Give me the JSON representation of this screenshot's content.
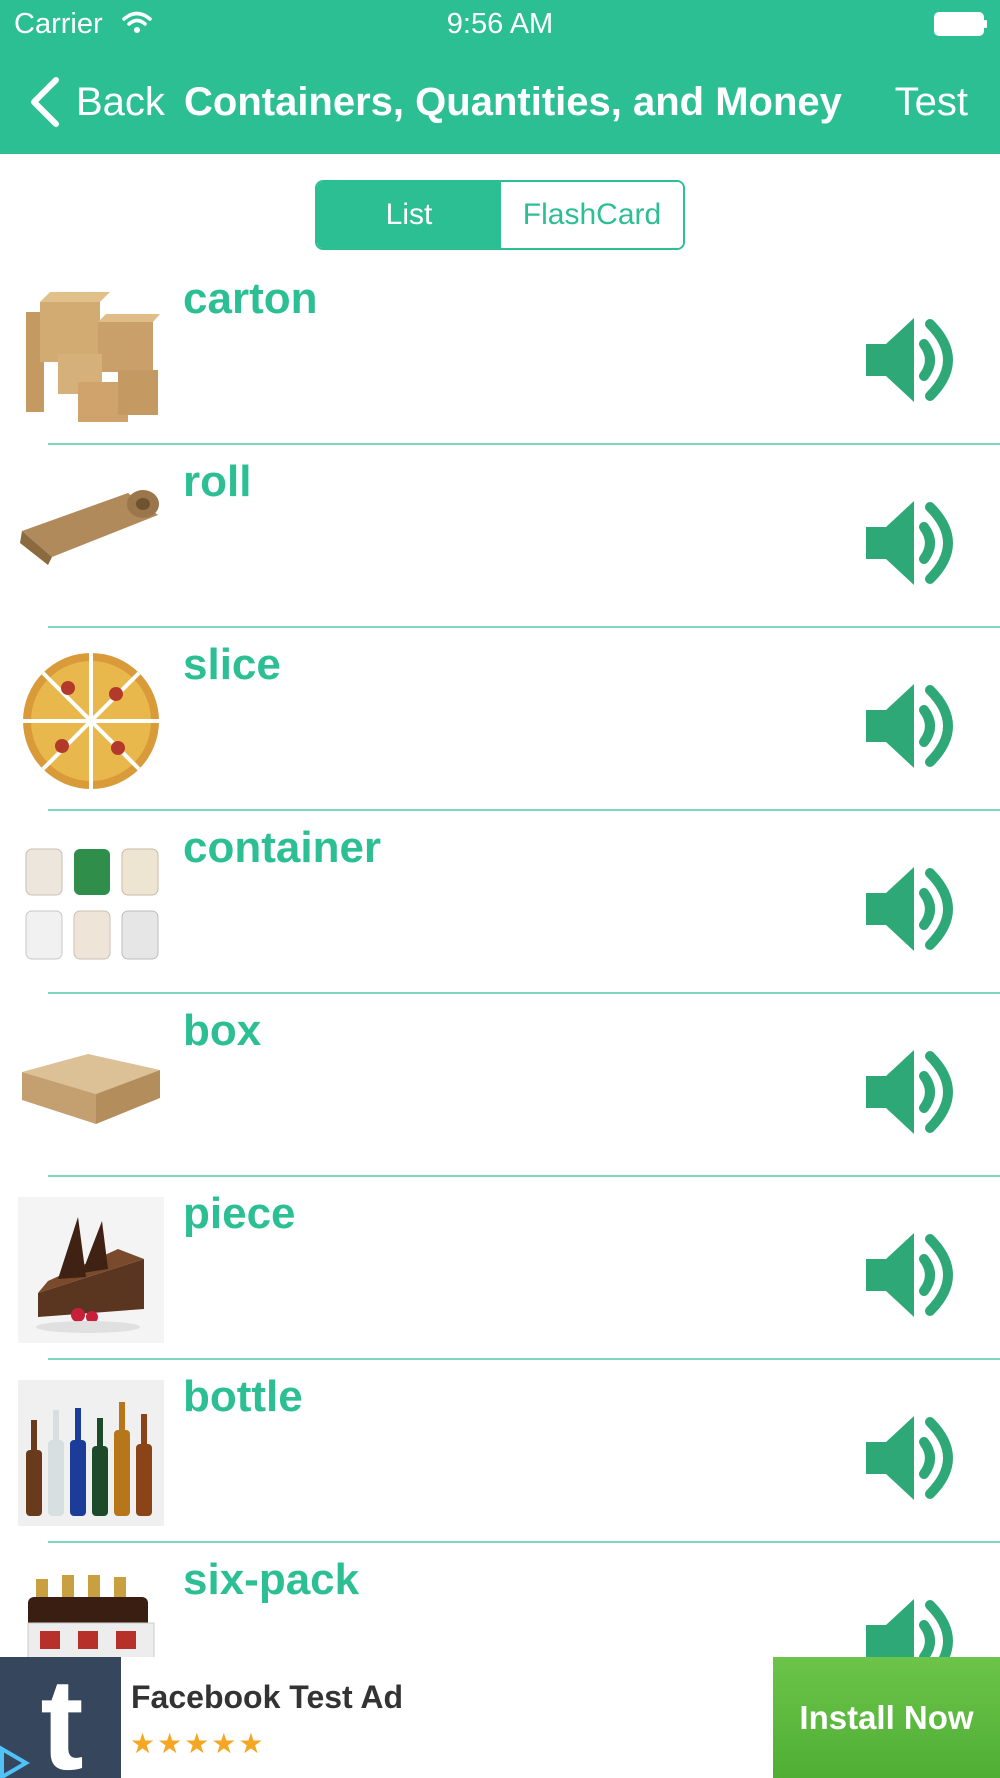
{
  "status_bar": {
    "carrier": "Carrier",
    "time": "9:56 AM"
  },
  "nav": {
    "back_label": "Back",
    "title": "Containers, Quantities, and Money",
    "test_label": "Test"
  },
  "segmented": {
    "list_label": "List",
    "flashcard_label": "FlashCard",
    "selected": "List"
  },
  "words": [
    {
      "word": "carton",
      "image": "cardboard-boxes"
    },
    {
      "word": "roll",
      "image": "rolled-mat"
    },
    {
      "word": "slice",
      "image": "pizza-slices"
    },
    {
      "word": "container",
      "image": "plastic-jugs"
    },
    {
      "word": "box",
      "image": "flat-box"
    },
    {
      "word": "piece",
      "image": "chocolate-cake-piece"
    },
    {
      "word": "bottle",
      "image": "glass-bottles"
    },
    {
      "word": "six-pack",
      "image": "six-pack-bottles"
    }
  ],
  "ad": {
    "title": "Facebook Test Ad",
    "stars": "★★★★★",
    "install_label": "Install Now"
  },
  "colors": {
    "accent": "#2dbf94",
    "install": "#5bb83e"
  }
}
